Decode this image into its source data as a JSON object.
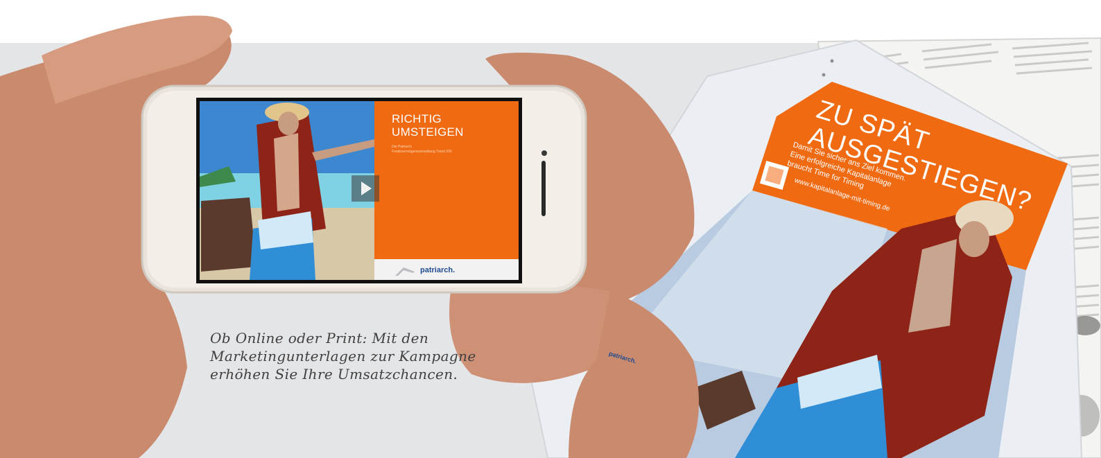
{
  "caption": {
    "line1": "Ob Online oder Print: Mit den",
    "line2": "Marketingunterlagen zur Kampagne",
    "line3": "erhöhen Sie Ihre Umsatzchancen."
  },
  "phone_ad": {
    "title_line1": "RICHTIG",
    "title_line2": "UMSTEIGEN",
    "sub_line1": "Die Patriarch",
    "sub_line2": "Fondsvermögensverwaltung Trend 200",
    "logo": "patriarch."
  },
  "print_ad": {
    "headline_line1": "ZU SPÄT",
    "headline_line2": "AUSGESTIEGEN?",
    "body_line1": "Damit Sie sicher ans Ziel kommen.",
    "body_line2": "Eine erfolgreiche Kapitalanlage",
    "body_line3": "braucht Time for Timing",
    "url": "www.kapitalanlage-mit-timing.de",
    "logo": "patriarch."
  },
  "colors": {
    "orange": "#f06a12",
    "background": "#e4e5e7",
    "brand_blue": "#1f4b8f"
  }
}
